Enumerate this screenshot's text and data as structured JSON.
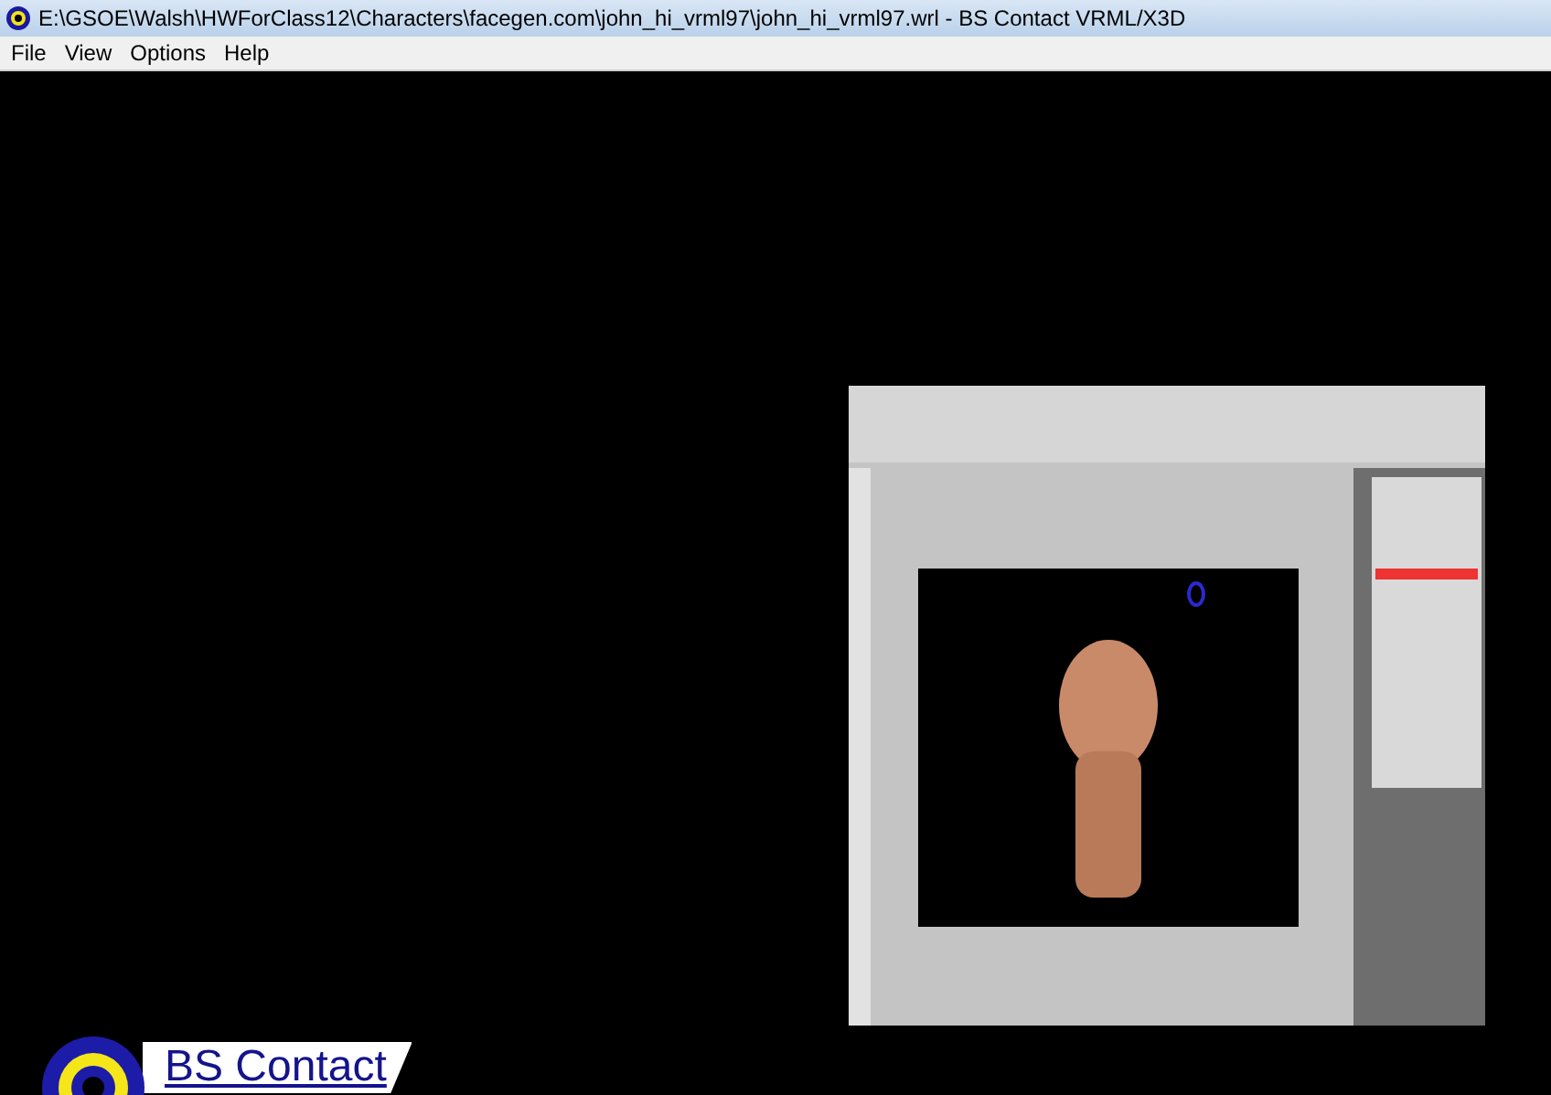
{
  "window": {
    "title": "E:\\GSOE\\Walsh\\HWForClass12\\Characters\\facegen.com\\john_hi_vrml97\\john_hi_vrml97.wrl - BS Contact VRML/X3D"
  },
  "menu": [
    "File",
    "View",
    "Options",
    "Help"
  ],
  "viewport": {
    "logo": {
      "text": "BS Contact"
    }
  }
}
